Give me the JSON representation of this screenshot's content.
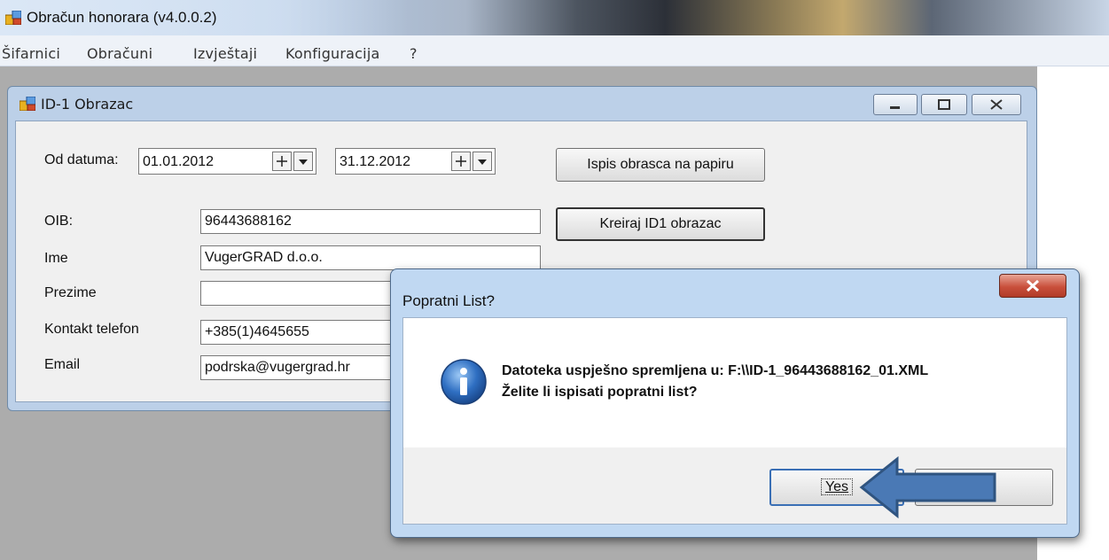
{
  "app": {
    "title": "Obračun honorara (v4.0.0.2)"
  },
  "menu": [
    "Šifarnici",
    "Obračuni",
    "Izvještaji",
    "Konfiguracija",
    "?"
  ],
  "child_window": {
    "title": "ID-1 Obrazac",
    "date_label": "Od datuma:",
    "date_from": "01.01.2012",
    "date_to": "31.12.2012",
    "print_button": "Ispis obrasca na papiru",
    "create_button": "Kreiraj ID1 obrazac",
    "fields": [
      {
        "label": "OIB:",
        "value": "96443688162"
      },
      {
        "label": "Ime",
        "value": "VugerGRAD d.o.o."
      },
      {
        "label": "Prezime",
        "value": ""
      },
      {
        "label": "Kontakt telefon",
        "value": "+385(1)4645655"
      },
      {
        "label": "Email",
        "value": "podrska@vugergrad.hr"
      }
    ]
  },
  "dialog": {
    "title": "Popratni List?",
    "message_line1": "Datoteka uspješno spremljena u: F:\\\\ID-1_96443688162_01.XML",
    "message_line2": "Želite li ispisati popratni list?",
    "yes_label": "Yes",
    "no_label": "No",
    "close_icon": "close-icon",
    "info_icon": "info-icon"
  },
  "annotation": {
    "arrow_color": "#4a79b5",
    "arrow_outline": "#2f5480"
  }
}
